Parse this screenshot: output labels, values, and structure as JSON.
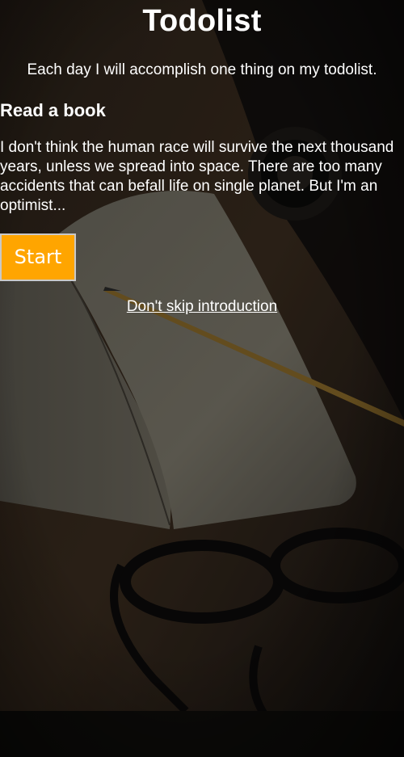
{
  "header": {
    "title": "Todolist",
    "subtitle": "Each day I will accomplish one thing on my todolist."
  },
  "task": {
    "title": "Read a book",
    "description": "I don't think the human race will survive the next thousand years, unless we spread into space. There are too many accidents that can befall life on single planet. But I'm an optimist..."
  },
  "actions": {
    "start_label": "Start",
    "skip_label": "Don't skip introduction"
  },
  "colors": {
    "accent": "#ffa500",
    "text": "#ffffff",
    "background": "#17130f"
  },
  "background_image": {
    "subject": "notebook-pencil-glasses-desk"
  }
}
